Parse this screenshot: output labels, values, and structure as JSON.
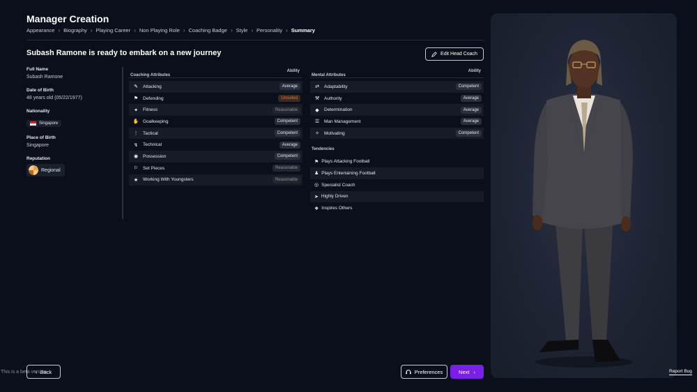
{
  "header": {
    "title": "Manager Creation",
    "breadcrumb": [
      "Appearance",
      "Biography",
      "Playing Career",
      "Non Playing Role",
      "Coaching Badge",
      "Style",
      "Personality",
      "Summary"
    ]
  },
  "headline": "Subash Ramone is ready to embark on a new journey",
  "edit_button": "Edit Head Coach",
  "info": {
    "full_name_label": "Full Name",
    "full_name": "Subash Ramone",
    "dob_label": "Date of Birth",
    "dob": "48 years old (05/22/1977)",
    "nationality_label": "Nationality",
    "nationality": "Singapore",
    "pob_label": "Place of Birth",
    "pob": "Singapore",
    "reputation_label": "Reputation",
    "reputation": "Regional"
  },
  "coaching": {
    "title": "Coaching Attributes",
    "ability_label": "Ability",
    "items": [
      {
        "name": "Attacking",
        "icon": "attacking-icon",
        "level": "Average"
      },
      {
        "name": "Defending",
        "icon": "defending-icon",
        "level": "Unsuited"
      },
      {
        "name": "Fitness",
        "icon": "fitness-icon",
        "level": "Reasonable"
      },
      {
        "name": "Goalkeeping",
        "icon": "goalkeeping-icon",
        "level": "Competent"
      },
      {
        "name": "Tactical",
        "icon": "tactical-icon",
        "level": "Competent"
      },
      {
        "name": "Technical",
        "icon": "technical-icon",
        "level": "Average"
      },
      {
        "name": "Possession",
        "icon": "possession-icon",
        "level": "Competent"
      },
      {
        "name": "Set Pieces",
        "icon": "set-pieces-icon",
        "level": "Reasonable"
      },
      {
        "name": "Working With Youngsters",
        "icon": "star-icon",
        "level": "Reasonable"
      }
    ]
  },
  "mental": {
    "title": "Mental Attributes",
    "ability_label": "Ability",
    "items": [
      {
        "name": "Adaptability",
        "icon": "adaptability-icon",
        "level": "Competent"
      },
      {
        "name": "Authority",
        "icon": "authority-icon",
        "level": "Average"
      },
      {
        "name": "Determination",
        "icon": "determination-icon",
        "level": "Average"
      },
      {
        "name": "Man Management",
        "icon": "man-management-icon",
        "level": "Average"
      },
      {
        "name": "Motivating",
        "icon": "motivating-icon",
        "level": "Competent"
      }
    ]
  },
  "tendencies": {
    "title": "Tendencies",
    "items": [
      {
        "name": "Plays Attacking Football",
        "icon": "attacking-football-icon"
      },
      {
        "name": "Plays Entertaining Football",
        "icon": "entertaining-football-icon"
      },
      {
        "name": "Specialist Coach",
        "icon": "specialist-coach-icon"
      },
      {
        "name": "Highly Driven",
        "icon": "highly-driven-icon"
      },
      {
        "name": "Inspires Others",
        "icon": "inspires-others-icon"
      }
    ]
  },
  "footer": {
    "back": "Back",
    "beta_note": "This is a beta version",
    "preferences": "Preferences",
    "next": "Next",
    "report_bug": "Report Bug"
  },
  "colors": {
    "background": "#0b0f1c",
    "accent": "#7a1fe6",
    "unsuited": "#e4773c"
  }
}
